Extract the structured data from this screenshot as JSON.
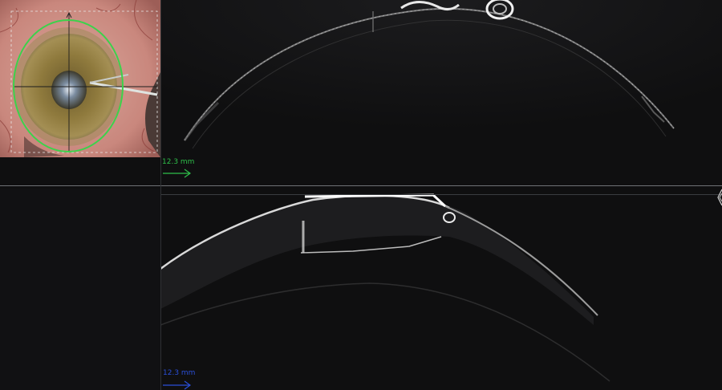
{
  "top_panel": {
    "scale_label": "12.3 mm",
    "scale_color": "#2fbf4a"
  },
  "bottom_panel": {
    "scale_label": "12.3 mm",
    "scale_color": "#2a4fd8"
  },
  "overlay": {
    "ring_color": "#3cd24b",
    "crosshair_color": "#1d1d1d"
  }
}
